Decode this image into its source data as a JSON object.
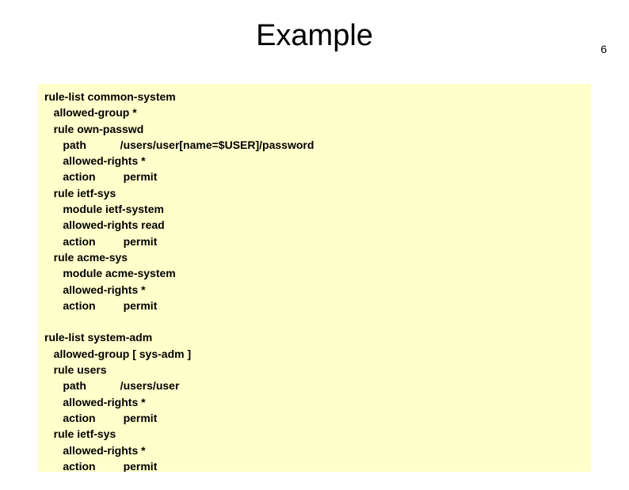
{
  "page_number": "6",
  "title": "Example",
  "code": "rule-list common-system\n   allowed-group *\n   rule own-passwd\n      path           /users/user[name=$USER]/password\n      allowed-rights *\n      action         permit\n   rule ietf-sys\n      module ietf-system\n      allowed-rights read\n      action         permit\n   rule acme-sys\n      module acme-system\n      allowed-rights *\n      action         permit\n\nrule-list system-adm\n   allowed-group [ sys-adm ]\n   rule users\n      path           /users/user\n      allowed-rights *\n      action         permit\n   rule ietf-sys\n      allowed-rights *\n      action         permit"
}
